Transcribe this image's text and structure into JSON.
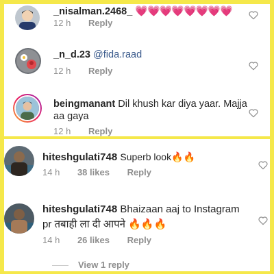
{
  "top_comments": [
    {
      "username": "_nisalman.2468_",
      "text": "💗💗💗💗💗💗💗💗",
      "time": "12 h",
      "reply": "Reply"
    },
    {
      "username": "_n_d.23",
      "mention": "@fida.raad",
      "time": "12 h",
      "reply": "Reply"
    },
    {
      "username": "beingmanant",
      "text_line1": "Dil khush kar diya yaar. Majja",
      "text_line2": "aa gaya",
      "time": "12 h",
      "reply": "Reply"
    }
  ],
  "bottom_comments": [
    {
      "username": "hiteshgulati748",
      "text": "Superb look🔥🔥",
      "time": "14 h",
      "likes": "38 likes",
      "reply": "Reply"
    },
    {
      "username": "hiteshgulati748",
      "text_line1": "Bhaizaan aaj to Instagram",
      "text_line2": "pr तबाही ला दी आपने 🔥🔥🔥",
      "time": "14 h",
      "likes": "26 likes",
      "reply": "Reply"
    }
  ],
  "view_replies": "View 1 reply",
  "colors": {
    "background": "#f5e84a",
    "mention": "#3a5a8c",
    "meta": "#8e8e8e"
  }
}
